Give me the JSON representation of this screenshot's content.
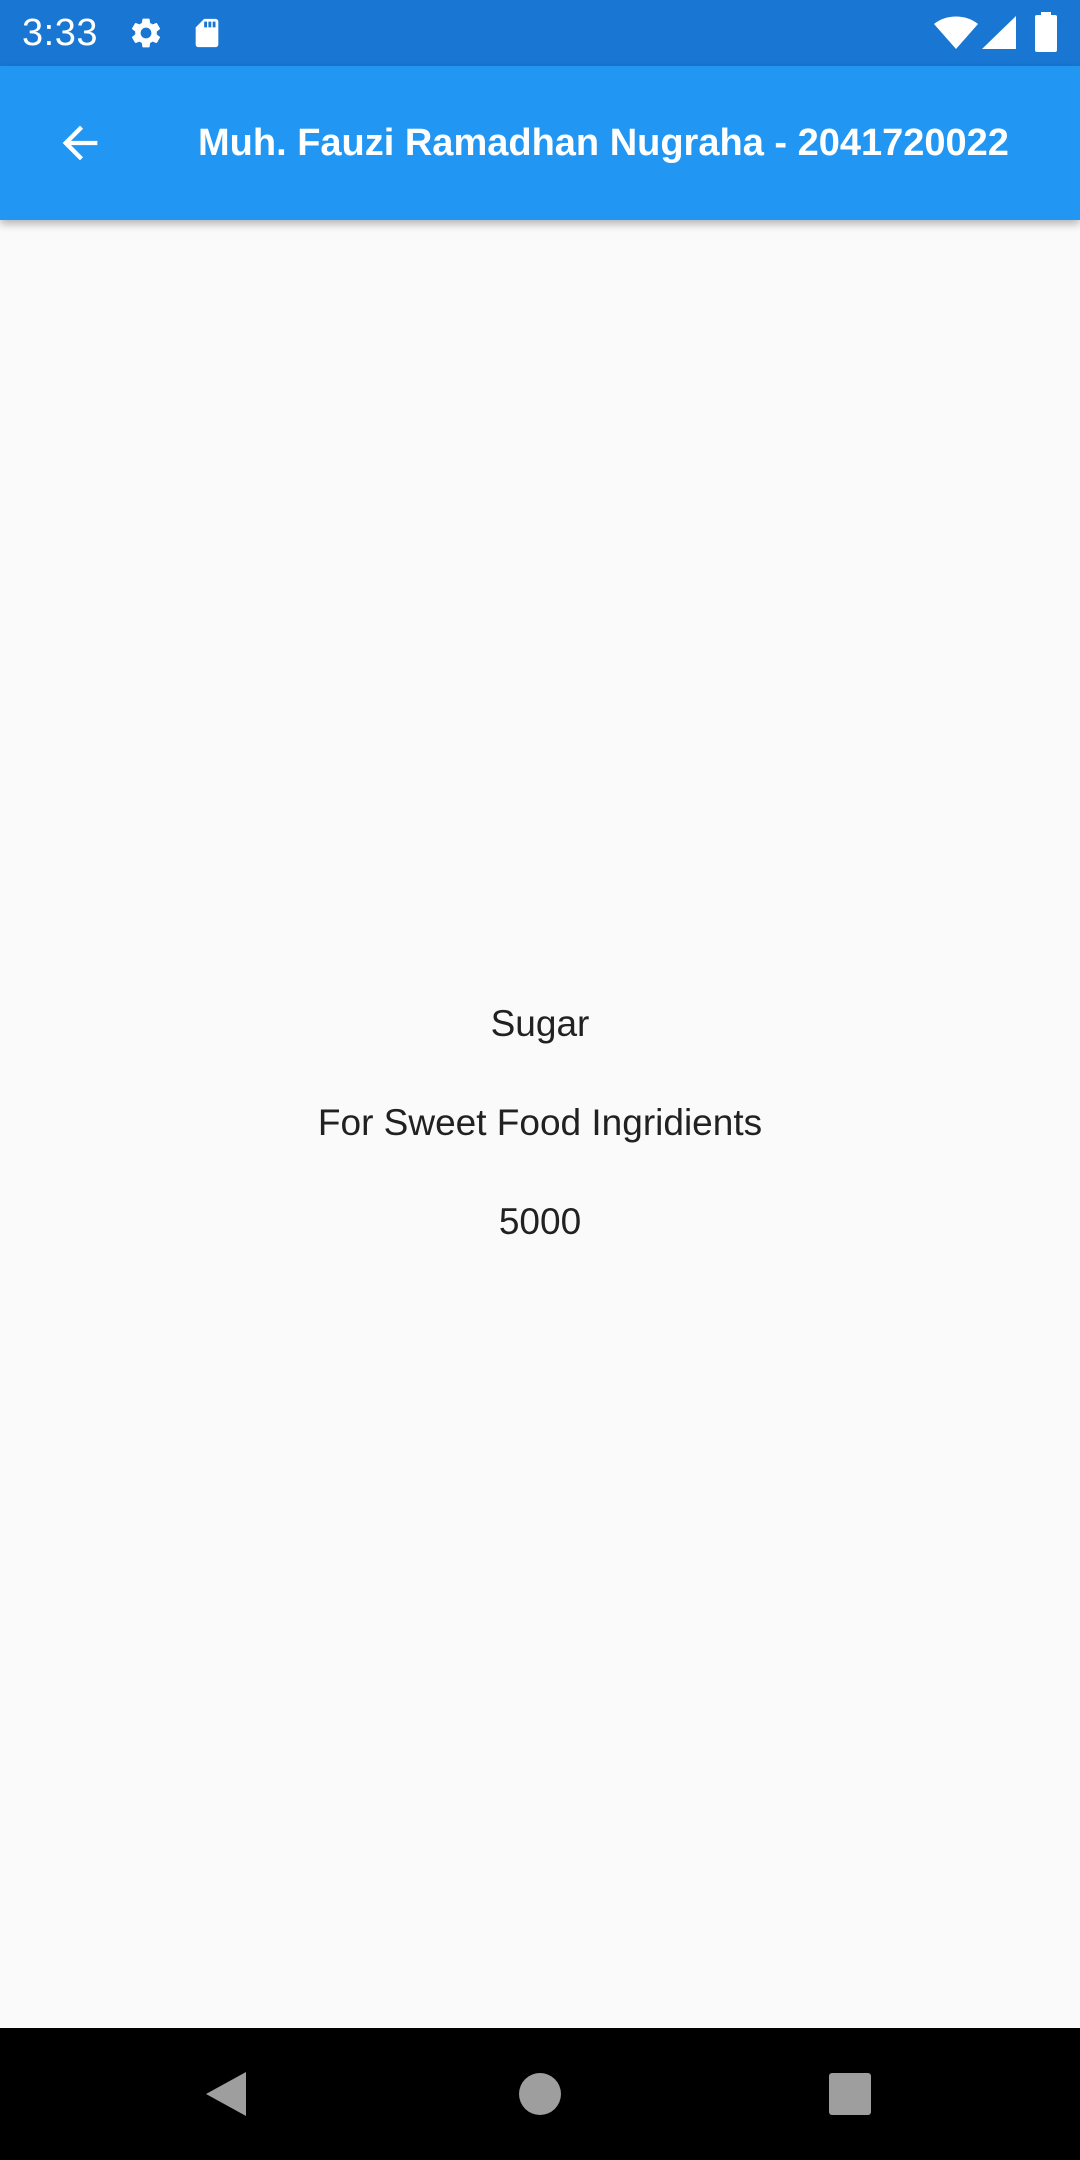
{
  "status_bar": {
    "time": "3:33",
    "icons": [
      "gear-icon",
      "sd-card-icon",
      "wifi-icon",
      "cell-signal-icon",
      "battery-icon"
    ]
  },
  "app_bar": {
    "back_icon": "arrow-left-icon",
    "title": "Muh. Fauzi Ramadhan Nugraha - 2041720022",
    "background_color": "#2196f3"
  },
  "item": {
    "name": "Sugar",
    "description": "For Sweet Food Ingridients",
    "price": "5000"
  },
  "nav_bar": {
    "buttons": [
      "back-triangle-icon",
      "home-circle-icon",
      "recents-square-icon"
    ]
  },
  "colors": {
    "status_bar": "#1976d2",
    "app_bar": "#2196f3",
    "background": "#fafafa",
    "text": "#212121",
    "nav_bar": "#000000"
  }
}
